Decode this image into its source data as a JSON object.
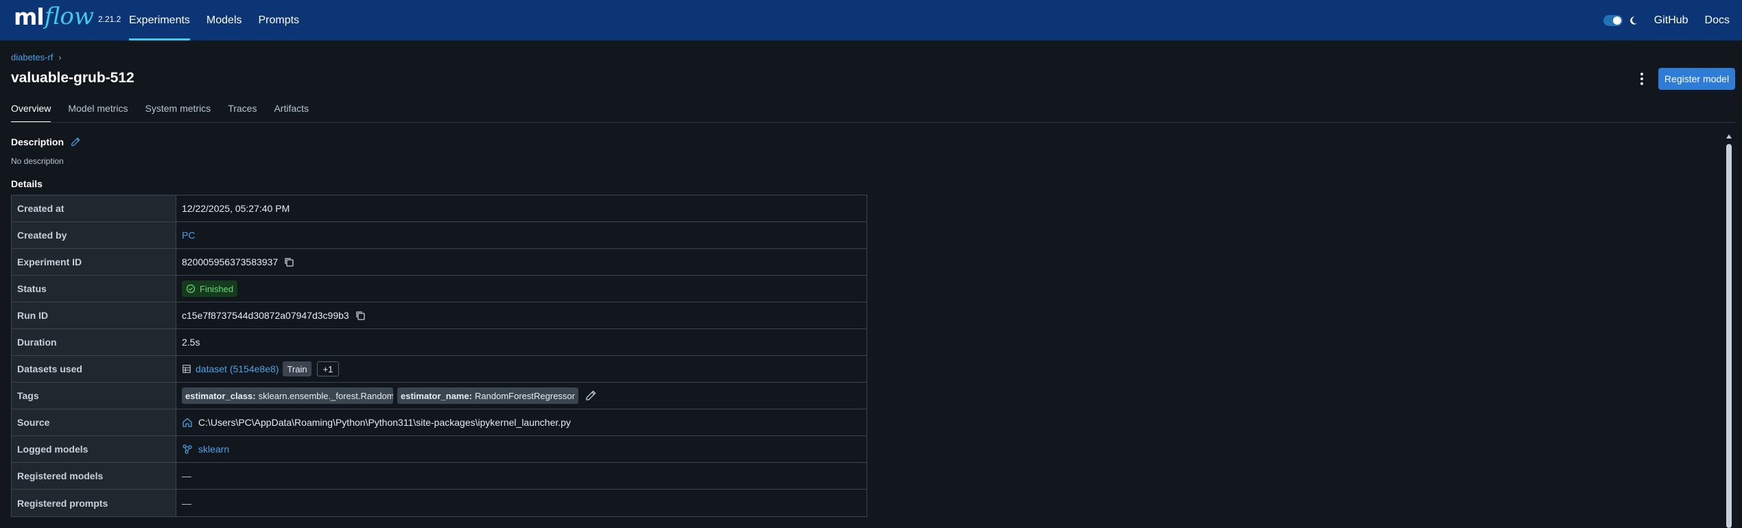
{
  "app": {
    "logo_ml": "ml",
    "logo_flow": "flow",
    "version": "2.21.2"
  },
  "nav": {
    "items": [
      {
        "label": "Experiments",
        "active": true
      },
      {
        "label": "Models",
        "active": false
      },
      {
        "label": "Prompts",
        "active": false
      }
    ],
    "github": "GitHub",
    "docs": "Docs",
    "dark_mode_on": true
  },
  "breadcrumb": {
    "experiment": "diabetes-rf",
    "separator": "›"
  },
  "run": {
    "title": "valuable-grub-512"
  },
  "actions": {
    "register_model": "Register model"
  },
  "tabs": [
    {
      "label": "Overview",
      "active": true
    },
    {
      "label": "Model metrics",
      "active": false
    },
    {
      "label": "System metrics",
      "active": false
    },
    {
      "label": "Traces",
      "active": false
    },
    {
      "label": "Artifacts",
      "active": false
    }
  ],
  "description": {
    "label": "Description",
    "value": "No description"
  },
  "details": {
    "label": "Details",
    "created_at": {
      "key": "Created at",
      "value": "12/22/2025, 05:27:40 PM"
    },
    "created_by": {
      "key": "Created by",
      "value": "PC"
    },
    "experiment_id": {
      "key": "Experiment ID",
      "value": "820005956373583937"
    },
    "status": {
      "key": "Status",
      "value": "Finished"
    },
    "run_id": {
      "key": "Run ID",
      "value": "c15e7f8737544d30872a07947d3c99b3"
    },
    "duration": {
      "key": "Duration",
      "value": "2.5s"
    },
    "datasets": {
      "key": "Datasets used",
      "name": "dataset (5154e8e8)",
      "context": "Train",
      "more": "+1"
    },
    "tags": {
      "key": "Tags",
      "items": [
        {
          "name": "estimator_class:",
          "value": "sklearn.ensemble._forest.Random..."
        },
        {
          "name": "estimator_name:",
          "value": "RandomForestRegressor"
        }
      ]
    },
    "source": {
      "key": "Source",
      "value": "C:\\Users\\PC\\AppData\\Roaming\\Python\\Python311\\site-packages\\ipykernel_launcher.py"
    },
    "logged_models": {
      "key": "Logged models",
      "value": "sklearn"
    },
    "registered_models": {
      "key": "Registered models",
      "value": "—"
    },
    "registered_prompts": {
      "key": "Registered prompts",
      "value": "—"
    }
  },
  "colors": {
    "header_bg": "#0b3575",
    "accent": "#43c9ed",
    "link": "#4ea1e8",
    "primary_button": "#2e7cd6",
    "success_bg": "#143c1c",
    "success_fg": "#6fd27d",
    "page_bg": "#11171d"
  }
}
